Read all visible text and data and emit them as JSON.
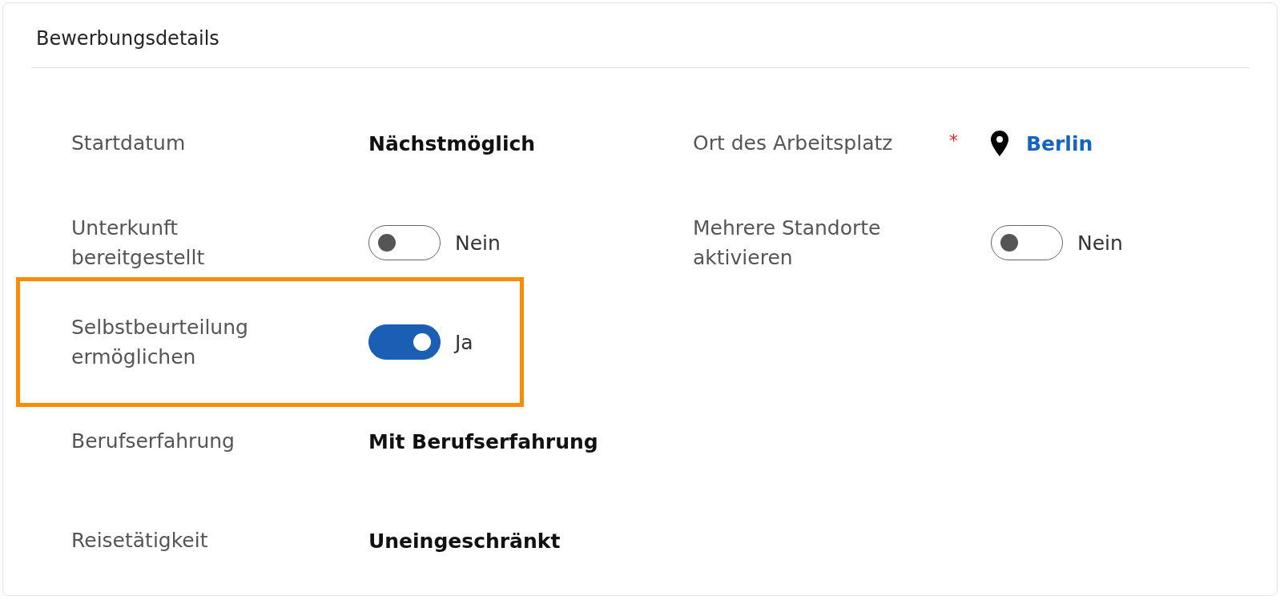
{
  "section": {
    "title": "Bewerbungsdetails"
  },
  "left_fields": [
    {
      "kind": "text",
      "label": "Startdatum",
      "value": "Nächstmöglich",
      "highlighted": false
    },
    {
      "kind": "toggle",
      "label": "Unterkunft bereitgestellt",
      "on": false,
      "value": "Nein",
      "highlighted": false
    },
    {
      "kind": "toggle",
      "label": "Selbstbeurteilung ermöglichen",
      "on": true,
      "value": "Ja",
      "highlighted": true
    },
    {
      "kind": "text",
      "label": "Berufserfahrung",
      "value": "Mit Berufserfahrung",
      "highlighted": false
    },
    {
      "kind": "text",
      "label": "Reisetätigkeit",
      "value": "Uneingeschränkt",
      "highlighted": false
    }
  ],
  "right_fields": [
    {
      "kind": "location",
      "label": "Ort des Arbeitsplatz",
      "required_mark": "*",
      "value": "Berlin"
    },
    {
      "kind": "toggle",
      "label": "Mehrere Standorte aktivieren",
      "on": false,
      "value": "Nein"
    }
  ]
}
